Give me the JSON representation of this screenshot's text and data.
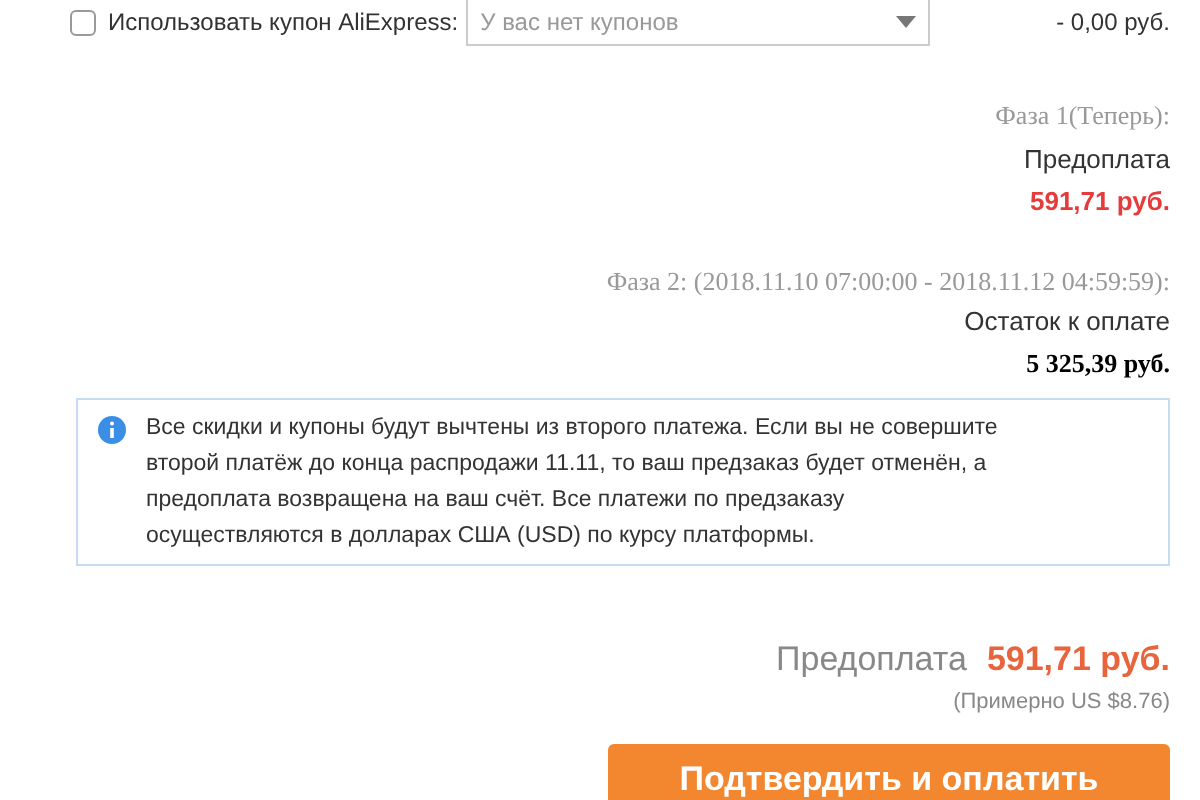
{
  "coupon": {
    "checked": false,
    "label": "Использовать купон AliExpress:",
    "placeholder": "У вас нет купонов",
    "discount": "- 0,00 руб."
  },
  "phase1": {
    "title": "Фаза 1(Теперь):",
    "label": "Предоплата",
    "amount": "591,71 руб."
  },
  "phase2": {
    "title": "Фаза 2: (2018.11.10 07:00:00 - 2018.11.12 04:59:59):",
    "label": "Остаток к оплате",
    "amount": "5 325,39 руб."
  },
  "notice": "Все скидки и купоны будут вычтены из второго платежа. Если вы не совершите второй платёж до конца распродажи 11.11, то ваш предзаказ будет отменён, а предоплата возвращена на ваш счёт. Все платежи по предзаказу осуществляются в долларах США (USD) по курсу платформы.",
  "total": {
    "label": "Предоплата",
    "amount": "591,71 руб.",
    "approx": "(Примерно US $8.76)"
  },
  "confirm_button": "Подтвердить и оплатить"
}
